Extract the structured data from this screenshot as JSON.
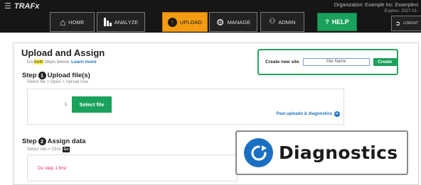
{
  "header": {
    "app_name": "TRAFx",
    "org_line": "Organization: Example Inc. Examplevi",
    "expires": "Expires: 2027-01-",
    "nav": {
      "home": "HOME",
      "analyze": "ANALYZE",
      "upload": "UPLOAD",
      "manage": "MANAGE",
      "admin": "ADMIN",
      "help": "HELP",
      "logout": "LOGOUT"
    },
    "icons": {
      "menu": "hamburger-icon",
      "home": "home-icon",
      "analyze": "bar-chart-icon",
      "upload": "upload-icon",
      "manage": "gears-icon",
      "admin": "users-icon",
      "help": "question-icon",
      "logout": "logout-icon"
    },
    "colors": {
      "upload_active": "#f39c12",
      "help": "#1aa15b"
    }
  },
  "page": {
    "title": "Upload and Assign",
    "subtitle_pre": "Do ",
    "subtitle_highlight": "both",
    "subtitle_post": " steps below.",
    "learn_more": "Learn more"
  },
  "create_site": {
    "label": "Create new site",
    "placeholder": "Site Name",
    "button": "Create"
  },
  "step1": {
    "label": "Step",
    "number": "1",
    "title": "Upload file(s)",
    "hint": "Select file > Open > Upload now",
    "row_number": "1.",
    "select_button": "Select file",
    "past_link": "Past uploads & diagnostics"
  },
  "step2": {
    "label": "Step",
    "number": "2",
    "title": "Assign data",
    "hint": "Select site > Click",
    "go": "Go",
    "warning": "Do step 1 first"
  },
  "diagnostics_overlay": {
    "label": "Diagnostics",
    "icon": "refresh-icon"
  }
}
